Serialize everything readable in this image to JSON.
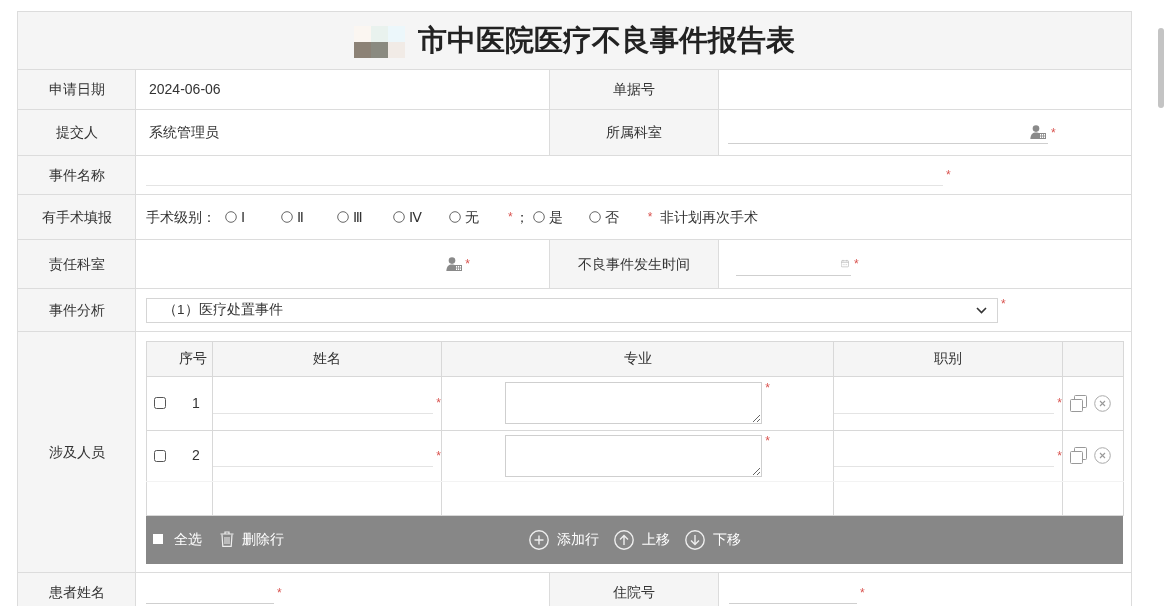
{
  "title": "市中医院医疗不良事件报告表",
  "rows": [
    {
      "kind": "pair",
      "cells": [
        {
          "kind": "label",
          "text": "申请日期"
        },
        {
          "kind": "text",
          "text": "2024-06-06"
        },
        {
          "kind": "label",
          "text": "单据号"
        },
        {
          "kind": "blank"
        }
      ]
    },
    {
      "kind": "pair",
      "cells": [
        {
          "kind": "label",
          "text": "提交人"
        },
        {
          "kind": "text",
          "text": "系统管理员"
        },
        {
          "kind": "label",
          "text": "所属科室"
        },
        {
          "kind": "picker",
          "required_mark": "*"
        }
      ]
    },
    {
      "kind": "wide",
      "cells": [
        {
          "kind": "label",
          "text": "事件名称"
        },
        {
          "kind": "line",
          "required_mark": "*"
        }
      ]
    },
    {
      "kind": "wide",
      "cells": [
        {
          "kind": "label",
          "text": "有手术填报"
        },
        {
          "kind": "choices",
          "parts": [
            {
              "kind": "caption",
              "text": "手术级别："
            },
            {
              "kind": "radios",
              "required_mark": "*",
              "options": [
                {
                  "label": "Ⅰ",
                  "selected": false
                },
                {
                  "label": "Ⅱ",
                  "selected": false
                },
                {
                  "label": "Ⅲ",
                  "selected": false
                },
                {
                  "label": "Ⅳ",
                  "selected": false
                },
                {
                  "label": "无",
                  "selected": false
                }
              ]
            },
            {
              "kind": "separator",
              "text": "；"
            },
            {
              "kind": "radios",
              "required_mark": "*",
              "options": [
                {
                  "label": "是",
                  "selected": false
                },
                {
                  "label": "否",
                  "selected": false
                }
              ]
            },
            {
              "kind": "caption",
              "text": "非计划再次手术"
            }
          ]
        }
      ]
    },
    {
      "kind": "pair",
      "cells": [
        {
          "kind": "label",
          "text": "责任科室"
        },
        {
          "kind": "picker-button",
          "required_mark": "*"
        },
        {
          "kind": "label",
          "text": "不良事件发生时间"
        },
        {
          "kind": "date",
          "required_mark": "*"
        }
      ]
    },
    {
      "kind": "wide",
      "cells": [
        {
          "kind": "label",
          "text": "事件分析"
        },
        {
          "kind": "select",
          "value": "（1）医疗处置事件",
          "required_mark": "*"
        }
      ]
    },
    {
      "kind": "wide",
      "cells": [
        {
          "kind": "label",
          "text": "涉及人员"
        },
        {
          "kind": "grid",
          "columns": [
            "序号",
            "姓名",
            "专业",
            "职别"
          ],
          "rows": [
            {
              "number": "1",
              "checked": false,
              "fields": [
                {
                  "kind": "line",
                  "required_mark": "*"
                },
                {
                  "kind": "textarea",
                  "required_mark": "*"
                },
                {
                  "kind": "line",
                  "required_mark": "*"
                }
              ],
              "actions": [
                {
                  "kind": "copy"
                },
                {
                  "kind": "remove"
                }
              ]
            },
            {
              "number": "2",
              "checked": false,
              "fields": [
                {
                  "kind": "line",
                  "required_mark": "*"
                },
                {
                  "kind": "textarea",
                  "required_mark": "*"
                },
                {
                  "kind": "line",
                  "required_mark": "*"
                }
              ],
              "actions": [
                {
                  "kind": "copy"
                },
                {
                  "kind": "remove"
                }
              ]
            }
          ],
          "toolbar": {
            "left": [
              {
                "kind": "select-all",
                "label": "全选"
              },
              {
                "kind": "delete",
                "label": "删除行"
              }
            ],
            "center": [
              {
                "kind": "add",
                "label": "添加行"
              },
              {
                "kind": "move-up",
                "label": "上移"
              },
              {
                "kind": "move-down",
                "label": "下移"
              }
            ]
          }
        }
      ]
    },
    {
      "kind": "pair",
      "cells": [
        {
          "kind": "label",
          "text": "患者姓名"
        },
        {
          "kind": "line",
          "required_mark": "*"
        },
        {
          "kind": "label",
          "text": "住院号"
        },
        {
          "kind": "line",
          "required_mark": "*"
        }
      ]
    }
  ]
}
